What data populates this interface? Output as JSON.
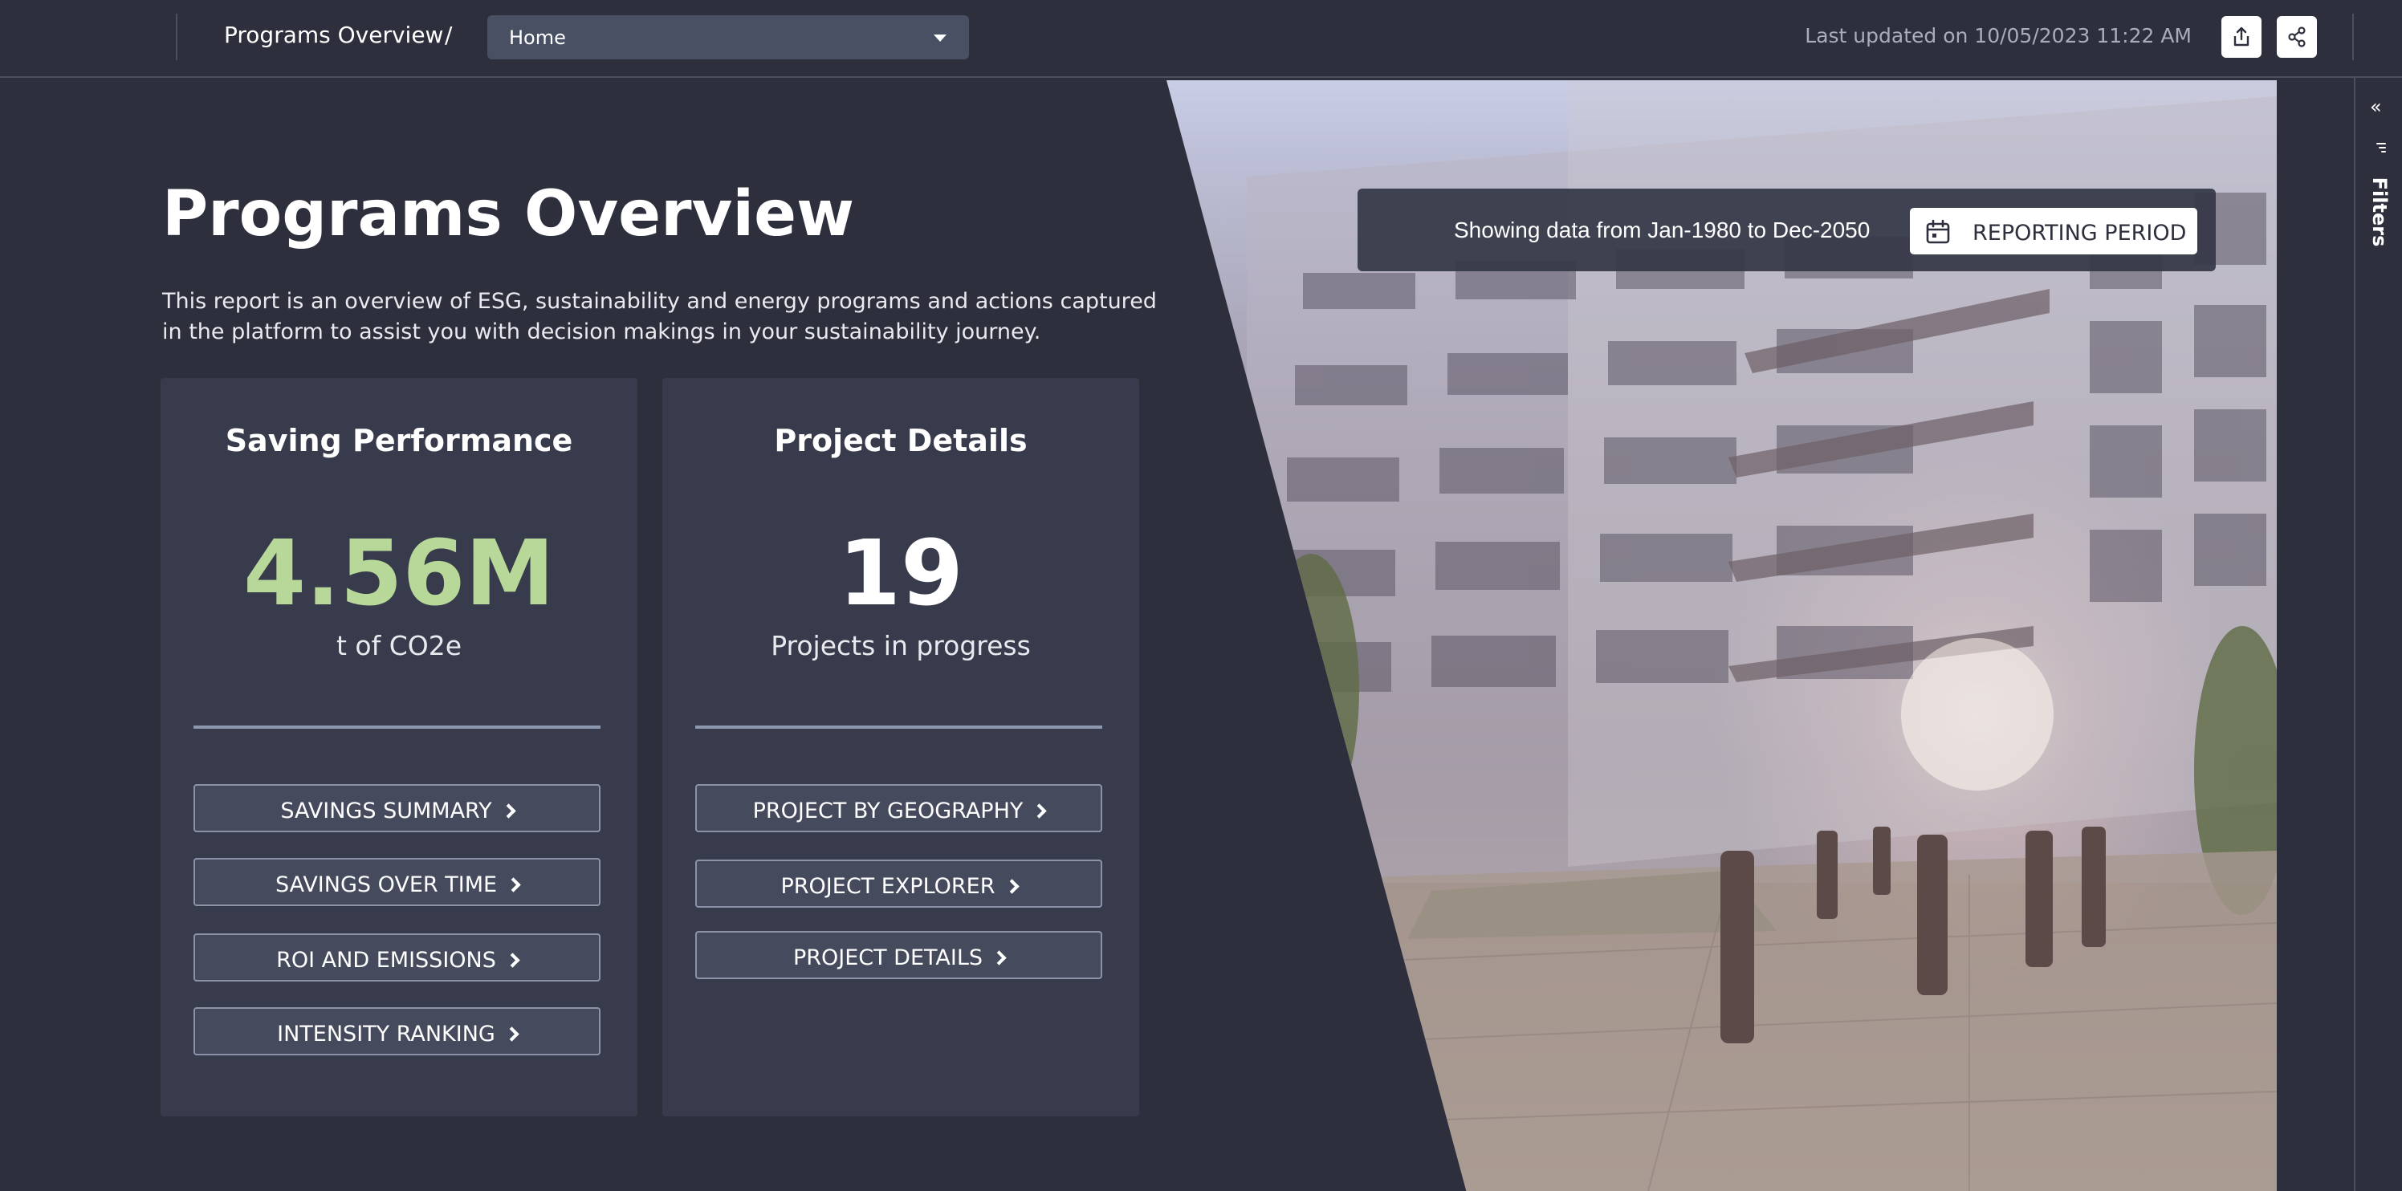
{
  "header": {
    "title": "Programs Overview",
    "separator": "/",
    "page_select": {
      "value": "Home"
    },
    "last_updated": "Last updated on 10/05/2023 11:22 AM",
    "icons": {
      "export": "export-icon",
      "share": "share-icon"
    }
  },
  "right_rail": {
    "collapse_glyph": "«",
    "filters_label": "Filters",
    "icons": {
      "collapse": "double-chevron-left-icon",
      "filter": "filter-icon"
    }
  },
  "hero": {
    "title": "Programs Overview",
    "description": "This report is an overview of ESG, sustainability and energy programs and actions captured in the platform to assist you with decision makings in your sustainability journey."
  },
  "reporting_period": {
    "text": "Showing data from Jan-1980 to Dec-2050",
    "button_label": "REPORTING PERIOD",
    "icon": "calendar-icon"
  },
  "saving_performance": {
    "title": "Saving Performance",
    "value": "4.56M",
    "unit": "t of CO2e",
    "buttons": [
      "SAVINGS SUMMARY",
      "SAVINGS OVER TIME",
      "ROI AND EMISSIONS",
      "INTENSITY RANKING"
    ]
  },
  "project_details": {
    "title": "Project Details",
    "value": "19",
    "unit": "Projects in progress",
    "buttons": [
      "PROJECT BY GEOGRAPHY",
      "PROJECT EXPLORER",
      "PROJECT DETAILS"
    ]
  },
  "colors": {
    "background": "#2d303c",
    "card": "#383b4b",
    "accent_green": "#b7d898",
    "select": "#4a5064"
  }
}
